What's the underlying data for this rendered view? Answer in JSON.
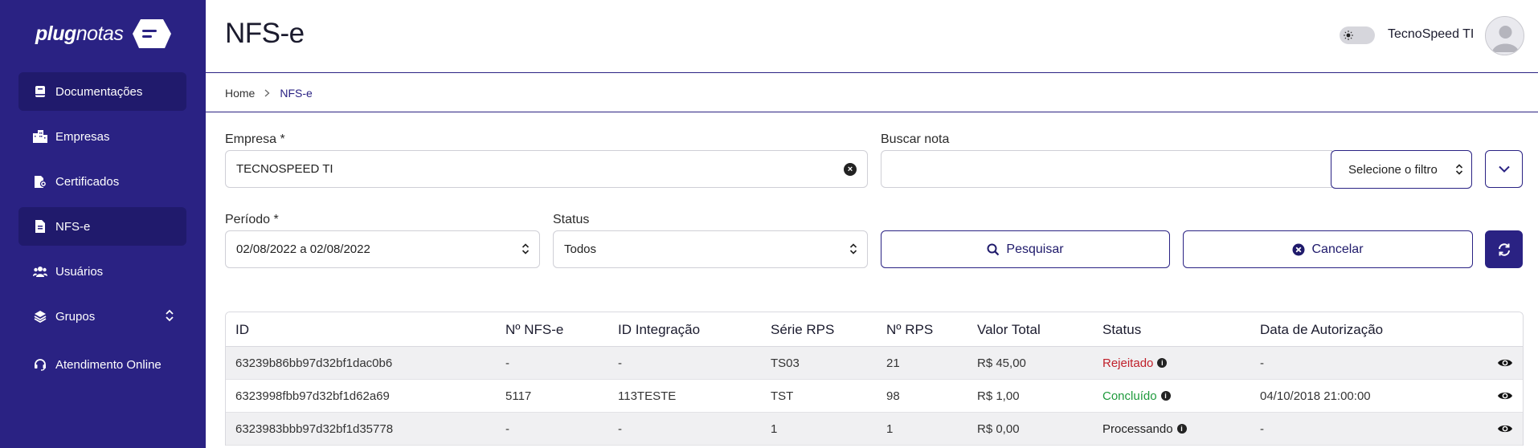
{
  "brand": {
    "logo_bold": "plug",
    "logo_light": "notas"
  },
  "sidebar": {
    "items": [
      {
        "label": "Documentações"
      },
      {
        "label": "Empresas"
      },
      {
        "label": "Certificados"
      },
      {
        "label": "NFS-e"
      },
      {
        "label": "Usuários"
      },
      {
        "label": "Grupos"
      },
      {
        "label": "Atendimento Online"
      }
    ]
  },
  "header": {
    "title": "NFS-e",
    "user_name": "TecnoSpeed TI"
  },
  "breadcrumb": {
    "home": "Home",
    "current": "NFS-e"
  },
  "form": {
    "empresa_label": "Empresa *",
    "empresa_value": "TECNOSPEED TI",
    "buscar_label": "Buscar nota",
    "buscar_value": "",
    "filter_select": "Selecione o filtro",
    "periodo_label": "Período *",
    "periodo_value": "02/08/2022 a 02/08/2022",
    "status_label": "Status",
    "status_value": "Todos",
    "search_button": "Pesquisar",
    "cancel_button": "Cancelar"
  },
  "table": {
    "headers": [
      "ID",
      "Nº NFS-e",
      "ID Integração",
      "Série RPS",
      "Nº RPS",
      "Valor Total",
      "Status",
      "Data de Autorização"
    ],
    "rows": [
      {
        "id": "63239b86bb97d32bf1dac0b6",
        "nfse": "-",
        "integracao": "-",
        "serie": "TS03",
        "rps": "21",
        "valor": "R$ 45,00",
        "status": "Rejeitado",
        "status_color": "#c0202a",
        "data": "-"
      },
      {
        "id": "6323998fbb97d32bf1d62a69",
        "nfse": "5117",
        "integracao": "113TESTE",
        "serie": "TST",
        "rps": "98",
        "valor": "R$ 1,00",
        "status": "Concluído",
        "status_color": "#1e9a3c",
        "data": "04/10/2018 21:00:00"
      },
      {
        "id": "6323983bbb97d32bf1d35778",
        "nfse": "-",
        "integracao": "-",
        "serie": "1",
        "rps": "1",
        "valor": "R$ 0,00",
        "status": "Processando",
        "status_color": "#222222",
        "data": "-"
      }
    ]
  },
  "colors": {
    "primary": "#2a2283",
    "sidebar_active": "#201a6c"
  },
  "icons": [
    "cloud-logo-icon",
    "book-icon",
    "building-icon",
    "certificate-icon",
    "document-icon",
    "users-icon",
    "layers-icon",
    "chevron-updown-icon",
    "headset-icon",
    "sun-icon",
    "user-avatar-icon",
    "close-circle-icon",
    "chevron-down-icon",
    "search-icon",
    "refresh-icon",
    "info-icon",
    "eye-icon"
  ]
}
